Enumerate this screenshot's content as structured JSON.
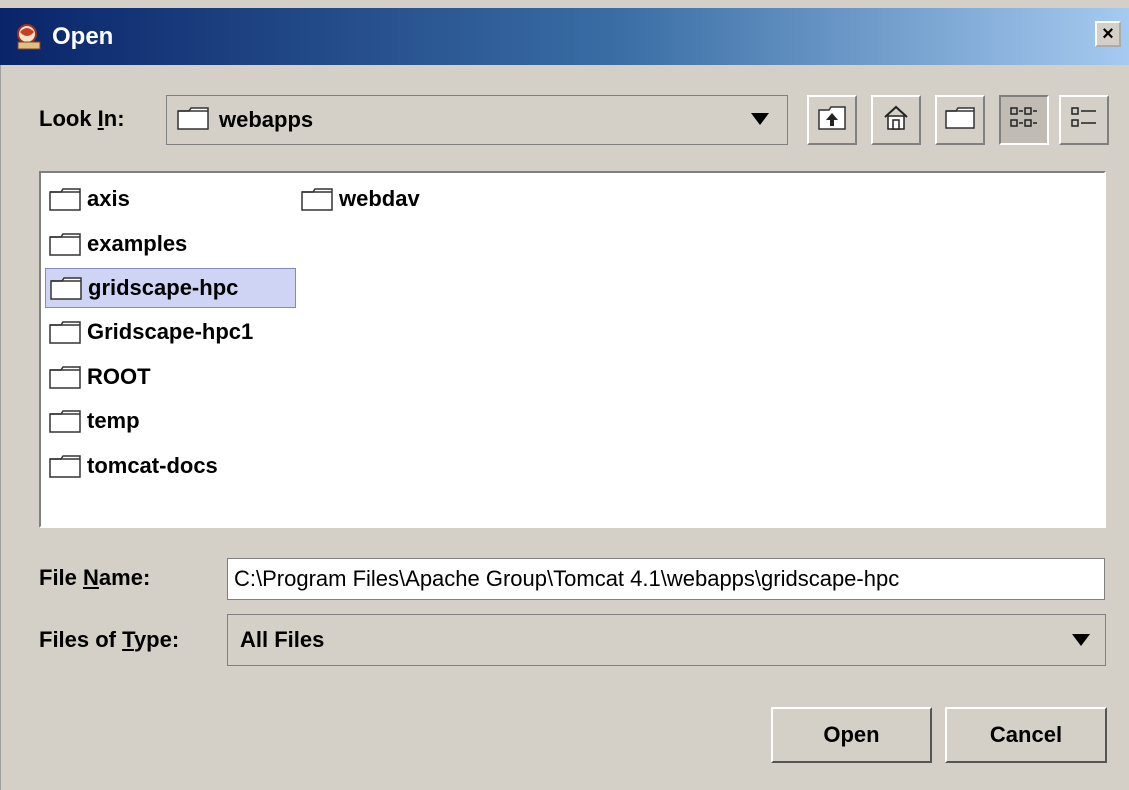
{
  "window": {
    "title": "Open",
    "close_glyph": "×",
    "icon": "app-icon"
  },
  "look_in": {
    "label_pre": "Look ",
    "label_mnemonic": "I",
    "label_post": "n:",
    "value": "webapps"
  },
  "toolbar": {
    "buttons": [
      "up-one-level",
      "home",
      "create-new-folder",
      "list-view",
      "details-view"
    ],
    "selected": "list-view"
  },
  "files": [
    {
      "name": "axis"
    },
    {
      "name": "examples"
    },
    {
      "name": "gridscape-hpc",
      "selected": true
    },
    {
      "name": "Gridscape-hpc1"
    },
    {
      "name": "ROOT"
    },
    {
      "name": "temp"
    },
    {
      "name": "tomcat-docs"
    },
    {
      "name": "webdav"
    }
  ],
  "file_name": {
    "label_pre": "File ",
    "label_mnemonic": "N",
    "label_post": "ame:",
    "value": "C:\\Program Files\\Apache Group\\Tomcat 4.1\\webapps\\gridscape-hpc"
  },
  "files_of_type": {
    "label_pre": "Files of ",
    "label_mnemonic": "T",
    "label_post": "ype:",
    "value": "All Files"
  },
  "buttons": {
    "open": "Open",
    "cancel": "Cancel"
  },
  "colors": {
    "title_start": "#0a246a",
    "title_end": "#a6caf0",
    "background": "#d4d0c8",
    "selection": "#d0d4f4"
  }
}
